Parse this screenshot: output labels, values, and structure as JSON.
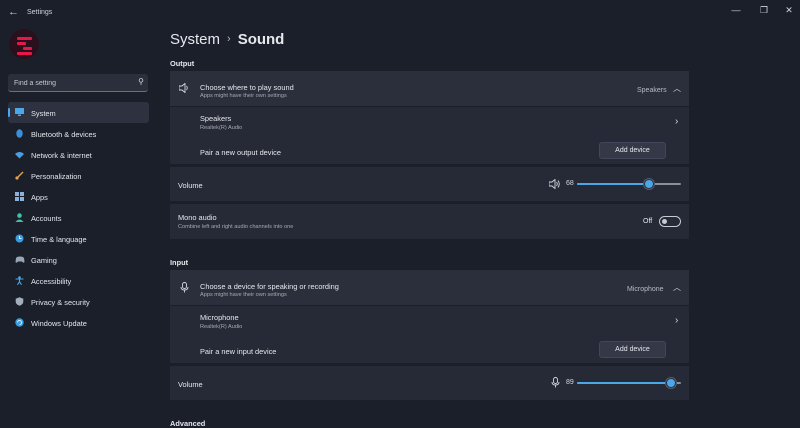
{
  "window": {
    "title": "Settings",
    "back_icon": "back-arrow-icon",
    "minimize": "—",
    "maximize": "❐",
    "close": "✕"
  },
  "accent_color": "#4aa8e8",
  "avatar": {
    "icon": "logo-avatar-icon",
    "color": "#e3194c"
  },
  "search": {
    "placeholder": "Find a setting",
    "value": "",
    "icon": "search-icon"
  },
  "nav": {
    "items": [
      {
        "label": "System",
        "icon": "system-icon",
        "active": true
      },
      {
        "label": "Bluetooth & devices",
        "icon": "bluetooth-icon"
      },
      {
        "label": "Network & internet",
        "icon": "wifi-icon"
      },
      {
        "label": "Personalization",
        "icon": "brush-icon"
      },
      {
        "label": "Apps",
        "icon": "apps-icon"
      },
      {
        "label": "Accounts",
        "icon": "person-icon"
      },
      {
        "label": "Time & language",
        "icon": "globe-clock-icon"
      },
      {
        "label": "Gaming",
        "icon": "gamepad-icon"
      },
      {
        "label": "Accessibility",
        "icon": "accessibility-icon"
      },
      {
        "label": "Privacy & security",
        "icon": "shield-icon"
      },
      {
        "label": "Windows Update",
        "icon": "update-icon"
      }
    ]
  },
  "breadcrumb": {
    "parent": "System",
    "separator": "›",
    "current": "Sound"
  },
  "output": {
    "heading": "Output",
    "choose": {
      "title": "Choose where to play sound",
      "subtitle": "Apps might have their own settings",
      "value": "Speakers",
      "icon": "speaker-icon"
    },
    "device": {
      "name": "Speakers",
      "driver": "Realtek(R) Audio"
    },
    "pair": {
      "label": "Pair a new output device",
      "button": "Add device"
    },
    "volume": {
      "label": "Volume",
      "value": "68",
      "level": 0.68,
      "icon": "speaker-volume-icon"
    },
    "mono": {
      "title": "Mono audio",
      "subtitle": "Combine left and right audio channels into one",
      "state": "Off"
    }
  },
  "input": {
    "heading": "Input",
    "choose": {
      "title": "Choose a device for speaking or recording",
      "subtitle": "Apps might have their own settings",
      "value": "Microphone",
      "icon": "microphone-icon"
    },
    "device": {
      "name": "Microphone",
      "driver": "Realtek(R) Audio"
    },
    "pair": {
      "label": "Pair a new input device",
      "button": "Add device"
    },
    "volume": {
      "label": "Volume",
      "value": "89",
      "level": 0.89,
      "icon": "microphone-icon"
    }
  },
  "advanced": {
    "heading": "Advanced"
  }
}
